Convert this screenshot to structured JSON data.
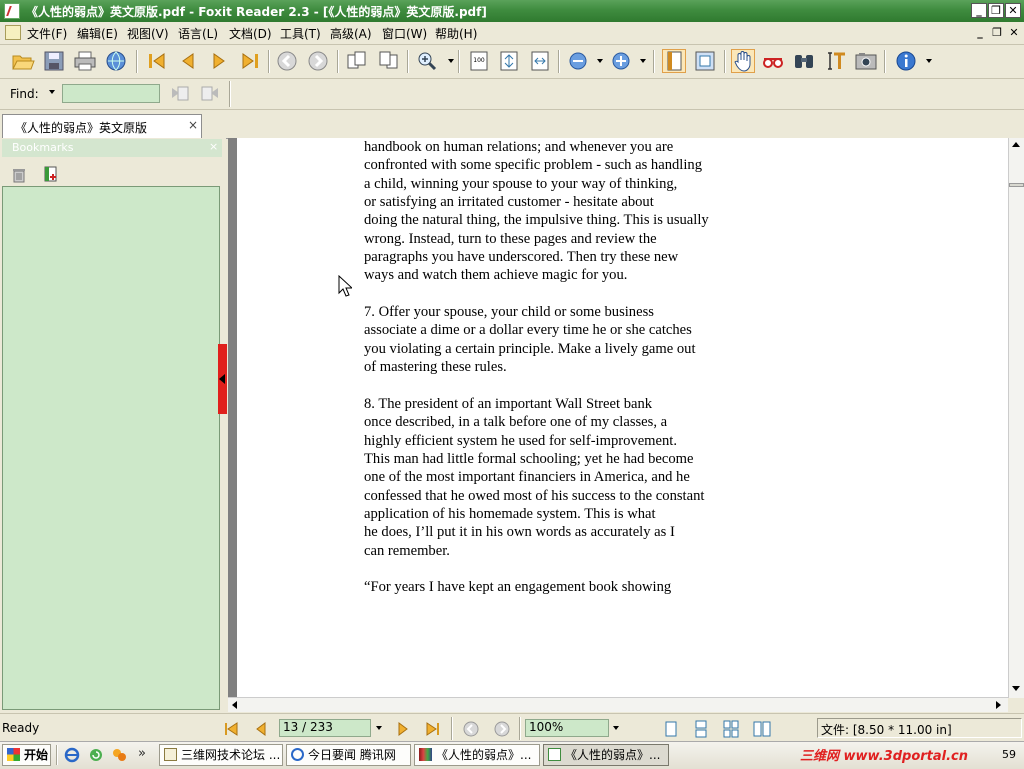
{
  "window": {
    "title": "《人性的弱点》英文原版.pdf - Foxit Reader 2.3 - [《人性的弱点》英文原版.pdf]"
  },
  "menu": [
    "文件(F)",
    "编辑(E)",
    "视图(V)",
    "语言(L)",
    "文档(D)",
    "工具(T)",
    "高级(A)",
    "窗口(W)",
    "帮助(H)"
  ],
  "find": {
    "label": "Find:",
    "value": ""
  },
  "tab": {
    "label": "《人性的弱点》英文原版"
  },
  "bookmarks": {
    "header": "Bookmarks"
  },
  "document": {
    "lines": [
      "handbook on human relations; and whenever you are",
      "confronted with some specific problem - such as handling",
      "a child, winning your spouse to your way of thinking,",
      "or satisfying an irritated customer - hesitate about",
      "doing the natural thing, the impulsive thing. This is usually",
      "wrong. Instead, turn to these pages and review the",
      "paragraphs you have underscored. Then try these new",
      "ways and watch them achieve magic for you.",
      "",
      "7. Offer your spouse, your child or some business",
      "associate a dime or a dollar every time he or she catches",
      "you violating a certain principle. Make a lively game out",
      "of mastering these rules.",
      "",
      "8. The president of an important Wall Street bank",
      "once described, in a talk before one of my classes, a",
      "highly efficient system he used for self-improvement.",
      "This man had little formal schooling; yet he had become",
      "one of the most important financiers in America, and he",
      "confessed that he owed most of his success to the constant",
      "application of his homemade system. This is what",
      "he does, I’ll put it in his own words as accurately as I",
      "can remember.",
      "",
      "“For years I have kept an engagement book showing"
    ]
  },
  "status": {
    "ready": "Ready",
    "page": "13 / 233",
    "zoom": "100%",
    "page_size": "文件: [8.50 * 11.00 in]"
  },
  "taskbar": {
    "start": "开始",
    "more": "»",
    "tasks": [
      "三维网技术论坛 ...",
      "今日要闻 腾讯网",
      "《人性的弱点》...",
      "《人性的弱点》..."
    ],
    "watermark": "三维网 www.3dportal.cn",
    "clock": "59"
  },
  "colors": {
    "title_green": "#3f8c3f",
    "panel_green": "#cde8c9",
    "handle_red": "#e0201c"
  }
}
